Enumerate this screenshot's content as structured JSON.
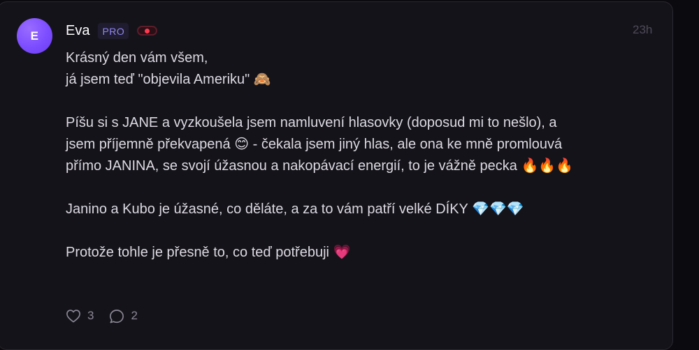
{
  "post": {
    "author": "Eva",
    "avatar_initial": "E",
    "badge": "PRO",
    "timestamp": "23h",
    "paragraphs": [
      {
        "lines": [
          "Krásný den vám všem,",
          "já jsem teď \"objevila Ameriku\" 🙈"
        ]
      },
      {
        "lines": [
          "Píšu si s JANE a vyzkoušela jsem namluvení hlasovky (doposud mi to nešlo), a",
          "jsem příjemně překvapená 😊 - čekala jsem jiný hlas, ale ona ke mně promlouvá",
          "přímo JANINA, se svojí úžasnou a nakopávací energií, to je vážně pecka 🔥🔥🔥"
        ]
      },
      {
        "lines": [
          "Janino a Kubo je úžasné, co děláte, a za to vám patří velké DÍKY 💎💎💎"
        ]
      },
      {
        "lines": [
          "Protože tohle je přesně to, co teď potřebuji 💗"
        ]
      }
    ],
    "likes": "3",
    "comments": "2"
  },
  "icons": {
    "like": "heart-icon",
    "comment": "comment-bubble-icon",
    "live": "live-indicator-icon"
  },
  "colors": {
    "background": "#0b0a0e",
    "card": "#15131a",
    "avatar": "#7c4dff",
    "badge_text": "#8f86f2",
    "live_dot": "#ff3a4f",
    "muted": "#8c8896"
  }
}
